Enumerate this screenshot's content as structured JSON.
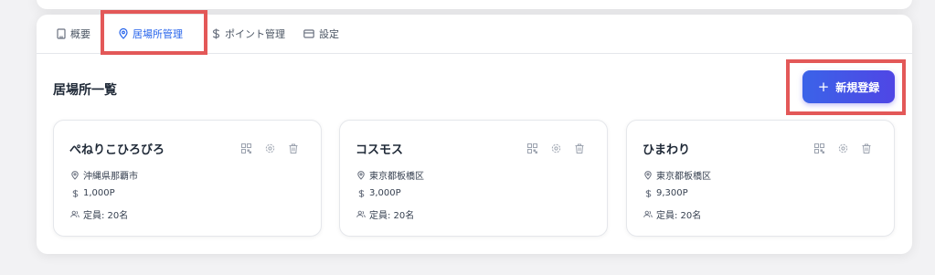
{
  "tabs": [
    {
      "label": "概要",
      "icon": "building-icon",
      "active": false
    },
    {
      "label": "居場所管理",
      "icon": "map-pin-icon",
      "active": true
    },
    {
      "label": "ポイント管理",
      "icon": "dollar-icon",
      "active": false
    },
    {
      "label": "設定",
      "icon": "card-icon",
      "active": false
    }
  ],
  "section": {
    "title": "居場所一覧",
    "add_button": {
      "icon": "+",
      "label": "新規登録"
    }
  },
  "cards": [
    {
      "name": "ぺねりこひろびろ",
      "location": "沖縄県那覇市",
      "price": "1,000P",
      "capacity": "定員: 20名"
    },
    {
      "name": "コスモス",
      "location": "東京都板橋区",
      "price": "3,000P",
      "capacity": "定員: 20名"
    },
    {
      "name": "ひまわり",
      "location": "東京都板橋区",
      "price": "9,300P",
      "capacity": "定員: 20名"
    }
  ],
  "colors": {
    "accent": "#2563eb",
    "button": "#4f46e5",
    "highlight": "#e35858"
  }
}
